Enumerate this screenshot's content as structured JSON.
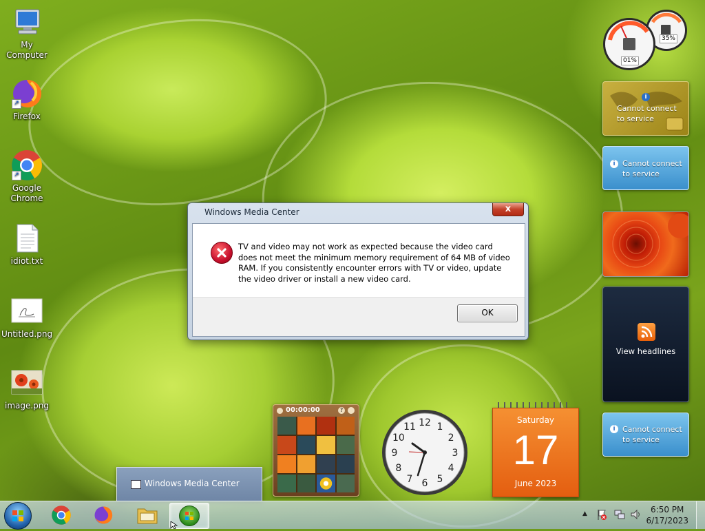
{
  "desktop_icons": [
    {
      "label": "My Computer"
    },
    {
      "label": "Firefox"
    },
    {
      "label": "Google Chrome"
    },
    {
      "label": "idiot.txt"
    },
    {
      "label": "Untitled.png"
    },
    {
      "label": "image.png"
    }
  ],
  "gadgets": {
    "cpu_meter": {
      "cpu_value": "01%",
      "memory_value": "35%"
    },
    "weather": {
      "message": "Cannot connect to service"
    },
    "currency": {
      "message": "Cannot connect to service"
    },
    "feed": {
      "label": "View headlines"
    },
    "stocks": {
      "message": "Cannot connect to service"
    },
    "puzzle": {
      "timer": "00:00:00"
    },
    "clock": {
      "numerals": [
        "12",
        "1",
        "2",
        "3",
        "4",
        "5",
        "6",
        "7",
        "8",
        "9",
        "10",
        "11"
      ]
    },
    "calendar": {
      "weekday": "Saturday",
      "day": "17",
      "month_year": "June 2023"
    }
  },
  "dialog": {
    "title": "Windows Media Center",
    "close_label": "x",
    "message": "TV and video may not work as expected because the video card does not meet the minimum memory requirement of 64 MB of video RAM. If you consistently encounter errors with TV or video, update the video driver or install a new video card.",
    "ok_label": "OK"
  },
  "taskbar": {
    "preview_title": "Windows Media Center",
    "time": "6:50 PM",
    "date": "6/17/2023"
  },
  "colors": {
    "accent": "#f26522",
    "error": "#c8102e",
    "taskbar": "#b9cfe0"
  }
}
